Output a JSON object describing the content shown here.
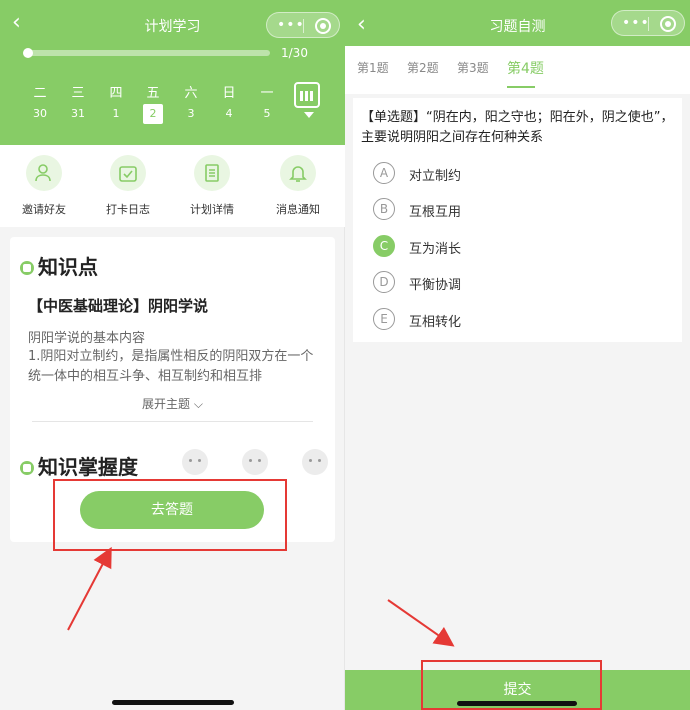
{
  "left": {
    "header": {
      "back_icon": "‹",
      "title": "计划学习"
    },
    "progress": {
      "text": "1/30",
      "fraction": 0.033
    },
    "week": {
      "days": [
        "二",
        "三",
        "四",
        "五",
        "六",
        "日",
        "一"
      ],
      "dates": [
        "30",
        "31",
        "1",
        "2",
        "3",
        "4",
        "5"
      ],
      "selected_index": 3
    },
    "actions": [
      "邀请好友",
      "打卡日志",
      "计划详情",
      "消息通知"
    ],
    "knowledge": {
      "heading": "知识点",
      "lesson_title": "【中医基础理论】阴阳学说",
      "subtitle": "阴阳学说的基本内容",
      "body": "1.阴阳对立制约，是指属性相反的阴阳双方在一个统一体中的相互斗争、相互制约和相互排",
      "expand": "展开主题"
    },
    "mastery": {
      "heading": "知识掌握度"
    },
    "go_button": "去答题"
  },
  "right": {
    "header": {
      "back_icon": "‹",
      "title": "习题自测"
    },
    "tabs": [
      "第1题",
      "第2题",
      "第3题",
      "第4题"
    ],
    "active_tab": 3,
    "question": "【单选题】“阴在内，阳之守也；阳在外，阴之使也”，主要说明阴阳之间存在何种关系",
    "options": [
      {
        "letter": "A",
        "text": "对立制约"
      },
      {
        "letter": "B",
        "text": "互根互用"
      },
      {
        "letter": "C",
        "text": "互为消长"
      },
      {
        "letter": "D",
        "text": "平衡协调"
      },
      {
        "letter": "E",
        "text": "互相转化"
      }
    ],
    "selected_option": 2,
    "submit": "提交"
  },
  "colors": {
    "accent": "#87cc66",
    "annotation": "#e53935"
  }
}
